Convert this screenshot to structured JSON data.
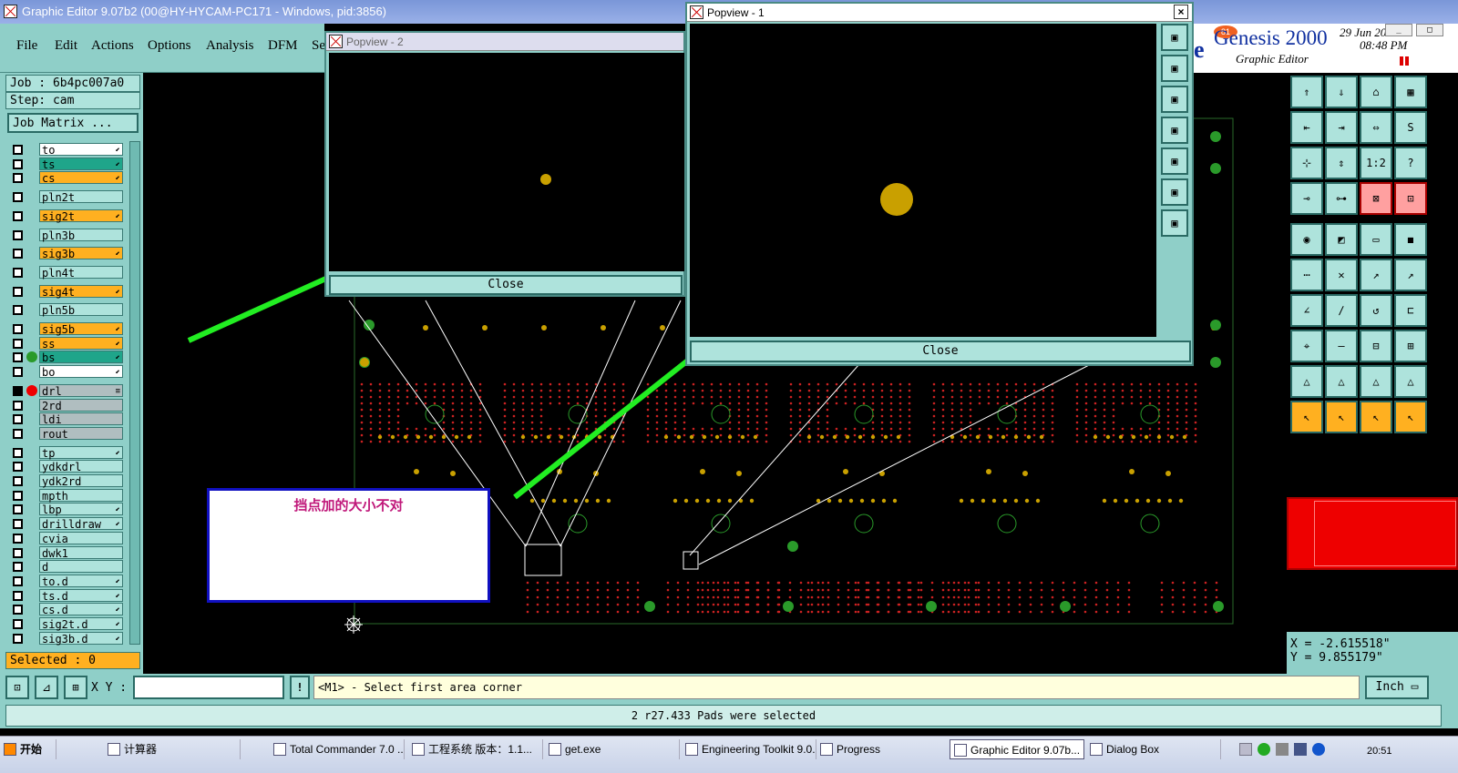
{
  "window": {
    "title": "Graphic Editor 9.07b2 (00@HY-HYCAM-PC171 - Windows, pid:3856)"
  },
  "menu": [
    "File",
    "Edit",
    "Actions",
    "Options",
    "Analysis",
    "DFM",
    "Se"
  ],
  "job": {
    "job_label": "Job : 6b4pc007a0",
    "step_label": "Step: cam",
    "matrix_button": "Job Matrix ..."
  },
  "layers": [
    {
      "name": "to",
      "color": "#ffffff",
      "arrow": "⬋"
    },
    {
      "name": "ts",
      "color": "#1fa58a",
      "arrow": "⬋"
    },
    {
      "name": "cs",
      "color": "#ffb020",
      "arrow": "⬋"
    },
    {
      "name": "pln2t",
      "color": "#aee3dc",
      "arrow": ""
    },
    {
      "name": "sig2t",
      "color": "#ffb020",
      "arrow": "⬋"
    },
    {
      "name": "pln3b",
      "color": "#aee3dc",
      "arrow": ""
    },
    {
      "name": "sig3b",
      "color": "#ffb020",
      "arrow": "⬋"
    },
    {
      "name": "pln4t",
      "color": "#aee3dc",
      "arrow": ""
    },
    {
      "name": "sig4t",
      "color": "#ffb020",
      "arrow": "⬋"
    },
    {
      "name": "pln5b",
      "color": "#aee3dc",
      "arrow": ""
    },
    {
      "name": "sig5b",
      "color": "#ffb020",
      "arrow": "⬋"
    },
    {
      "name": "ss",
      "color": "#ffb020",
      "arrow": "⬋"
    },
    {
      "name": "bs",
      "color": "#1fa58a",
      "arrow": "⬋"
    },
    {
      "name": "bo",
      "color": "#ffffff",
      "arrow": "⬋"
    },
    {
      "name": "drl",
      "color": "#b0bec0",
      "arrow": "≡"
    },
    {
      "name": "2rd",
      "color": "#b0bec0",
      "arrow": ""
    },
    {
      "name": "ldi",
      "color": "#b0bec0",
      "arrow": ""
    },
    {
      "name": "rout",
      "color": "#b0bec0",
      "arrow": ""
    },
    {
      "name": "tp",
      "color": "#aee3dc",
      "arrow": "⬋"
    },
    {
      "name": "ydkdrl",
      "color": "#aee3dc",
      "arrow": ""
    },
    {
      "name": "ydk2rd",
      "color": "#aee3dc",
      "arrow": ""
    },
    {
      "name": "mpth",
      "color": "#aee3dc",
      "arrow": ""
    },
    {
      "name": "lbp",
      "color": "#aee3dc",
      "arrow": "⬋"
    },
    {
      "name": "drilldraw",
      "color": "#aee3dc",
      "arrow": "⬋"
    },
    {
      "name": "cvia",
      "color": "#aee3dc",
      "arrow": ""
    },
    {
      "name": "dwk1",
      "color": "#aee3dc",
      "arrow": ""
    },
    {
      "name": "d",
      "color": "#aee3dc",
      "arrow": ""
    },
    {
      "name": "to.d",
      "color": "#aee3dc",
      "arrow": "⬋"
    },
    {
      "name": "ts.d",
      "color": "#aee3dc",
      "arrow": "⬋"
    },
    {
      "name": "cs.d",
      "color": "#aee3dc",
      "arrow": "⬋"
    },
    {
      "name": "sig2t.d",
      "color": "#aee3dc",
      "arrow": "⬋"
    },
    {
      "name": "sig3b.d",
      "color": "#aee3dc",
      "arrow": "⬋"
    }
  ],
  "selected_label": "Selected : 0",
  "brand": {
    "name": "Genesis 2000",
    "sub": "Graphic Editor",
    "date": "29 Jun 2016",
    "time": "08:48 PM",
    "badge": "81"
  },
  "popview1": {
    "title": "Popview - 1",
    "close": "Close"
  },
  "popview2": {
    "title": "Popview - 2",
    "close": "Close"
  },
  "annotation": {
    "text": "挡点加的大小不对"
  },
  "coords": {
    "x": "X = -2.615518\"",
    "y": "Y = 9.855179\""
  },
  "cmd": {
    "xy_label": "X Y :",
    "prompt": "<M1> - Select first area corner",
    "units": "Inch"
  },
  "status": {
    "message": "2 r27.433 Pads were selected"
  },
  "taskbar": {
    "start": "开始",
    "items": [
      "计算器",
      "Total Commander 7.0 ...",
      "工程系统  版本：1.1...",
      "get.exe",
      "Engineering Toolkit 9.0...",
      "Progress",
      "Graphic Editor 9.07b...",
      "Dialog Box"
    ],
    "clock": "20:51"
  },
  "colors": {
    "teal": "#8fcfc8",
    "pad": "#c9a000",
    "arrow": "#22ee22",
    "drill": "#cc2222"
  }
}
